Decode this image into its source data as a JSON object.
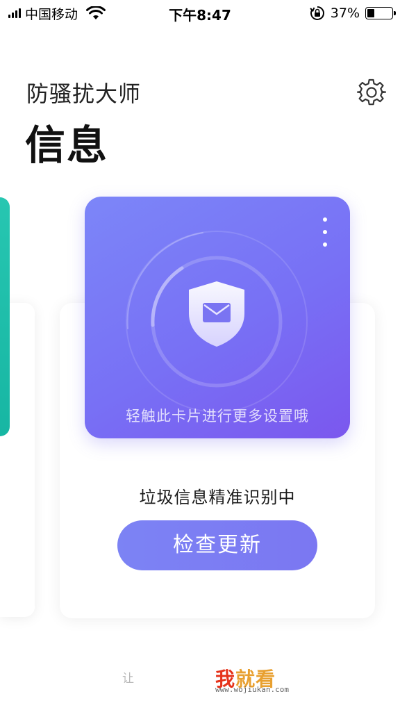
{
  "status_bar": {
    "carrier": "中国移动",
    "time": "下午8:47",
    "battery_percent": "37%",
    "battery_level": 0.37,
    "icons": [
      "signal-icon",
      "wifi-icon",
      "rotation-lock-icon",
      "battery-icon"
    ]
  },
  "header": {
    "app_title": "防骚扰大师",
    "page_title": "信息",
    "settings_icon": "gear-icon"
  },
  "feature_card": {
    "hint": "轻触此卡片进行更多设置哦",
    "more_icon": "more-vertical-icon",
    "shield_icon": "shield-mail-icon",
    "accent_start": "#7c86f8",
    "accent_end": "#7b57ee"
  },
  "main": {
    "status_text": "垃圾信息精准识别中",
    "check_update_label": "检查更新"
  },
  "side_card": {
    "color": "#27c6b1"
  },
  "bottom": {
    "partial_label": "让"
  },
  "watermark": {
    "main_first": "我",
    "main_rest": "就看",
    "url": "www.wojiukan.com"
  }
}
